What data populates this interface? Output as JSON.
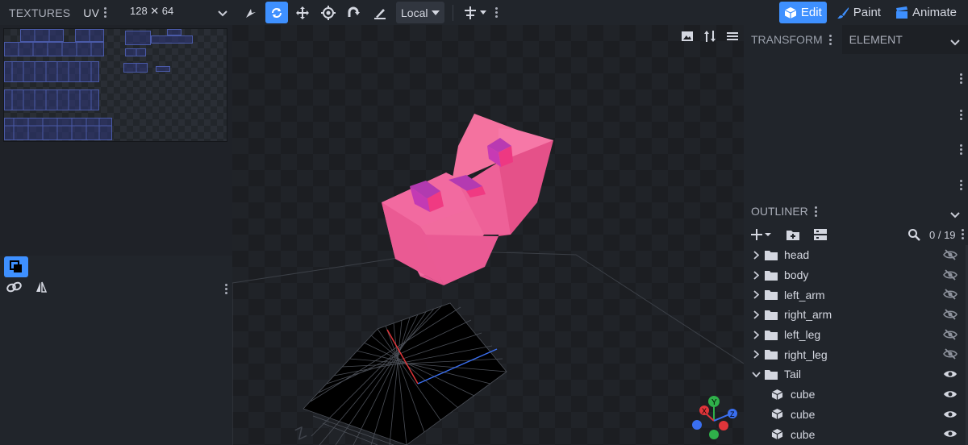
{
  "topbar": {
    "textures_tab": "TEXTURES",
    "uv_tab": "UV",
    "resolution": "128 ✕ 64",
    "transform_space": "Local",
    "modes": [
      {
        "label": "Edit",
        "icon": "cube-icon",
        "selected": true
      },
      {
        "label": "Paint",
        "icon": "brush-icon",
        "selected": false
      },
      {
        "label": "Animate",
        "icon": "clapperboard-icon",
        "selected": false
      }
    ]
  },
  "panels": {
    "transform_tab": "TRANSFORM",
    "element_tab": "ELEMENT",
    "outliner_title": "OUTLINER",
    "outliner_count": "0 / 19"
  },
  "outliner": {
    "items": [
      {
        "label": "head",
        "type": "folder",
        "visible": false
      },
      {
        "label": "body",
        "type": "folder",
        "visible": false
      },
      {
        "label": "left_arm",
        "type": "folder",
        "visible": false
      },
      {
        "label": "right_arm",
        "type": "folder",
        "visible": false
      },
      {
        "label": "left_leg",
        "type": "folder",
        "visible": false
      },
      {
        "label": "right_leg",
        "type": "folder",
        "visible": false
      },
      {
        "label": "Tail",
        "type": "folder",
        "visible": true,
        "expanded": true
      },
      {
        "label": "cube",
        "type": "cube",
        "visible": true
      },
      {
        "label": "cube",
        "type": "cube",
        "visible": true
      },
      {
        "label": "cube",
        "type": "cube",
        "visible": true
      }
    ]
  },
  "gizmo": {
    "x": "X",
    "y": "Y",
    "z": "Z"
  },
  "colors": {
    "accent": "#3e90ff",
    "model": "#f06a9a",
    "model_dark": "#d94f85",
    "axis_x": "#e0353a",
    "axis_z": "#3a6ff0"
  }
}
